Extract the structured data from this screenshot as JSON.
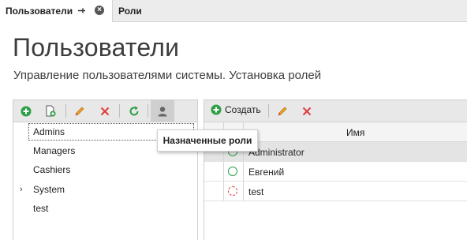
{
  "tabs": [
    {
      "label": "Пользователи"
    },
    {
      "label": "Роли"
    }
  ],
  "header": {
    "title": "Пользователи",
    "subtitle": "Управление пользователями системы. Установка ролей"
  },
  "tree": {
    "items": [
      {
        "label": "Admins"
      },
      {
        "label": "Managers"
      },
      {
        "label": "Cashiers"
      },
      {
        "label": "System"
      },
      {
        "label": "test"
      }
    ]
  },
  "tooltip": {
    "text": "Назначенные роли"
  },
  "users_toolbar": {
    "create_label": "Создать"
  },
  "grid": {
    "name_header": "Имя",
    "rows": [
      {
        "name": "Administrator"
      },
      {
        "name": "Евгений"
      },
      {
        "name": "test"
      }
    ]
  },
  "colors": {
    "green": "#2e9e47",
    "red": "#e03a3a",
    "pencil": "#f0a020"
  }
}
